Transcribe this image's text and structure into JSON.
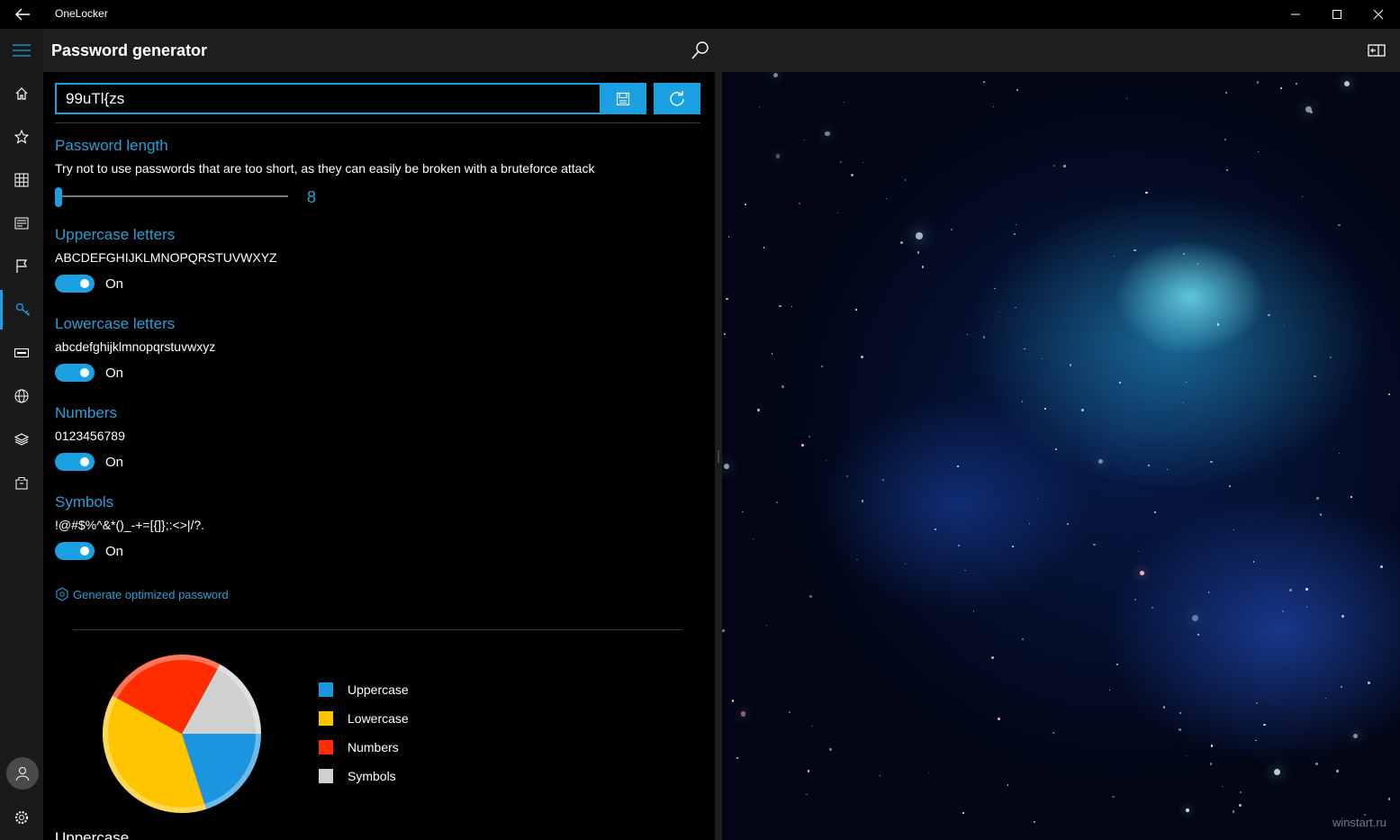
{
  "app": {
    "title": "OneLocker"
  },
  "header": {
    "page_title": "Password generator"
  },
  "generator": {
    "password_value": "99uTl{zs",
    "length_title": "Password length",
    "length_description": "Try not to use passwords that are too short, as they can easily be broken with a bruteforce attack",
    "length_value": "8",
    "length_level": 0.0
  },
  "options": [
    {
      "title": "Uppercase letters",
      "charset": "ABCDEFGHIJKLMNOPQRSTUVWXYZ",
      "state": "On"
    },
    {
      "title": "Lowercase letters",
      "charset": "abcdefghijklmnopqrstuvwxyz",
      "state": "On"
    },
    {
      "title": "Numbers",
      "charset": "0123456789",
      "state": "On"
    },
    {
      "title": "Symbols",
      "charset": "!@#$%^&*()_-+=[{]};:<>|/?.",
      "state": "On"
    }
  ],
  "generate_link": "Generate optimized password",
  "chart_data": {
    "type": "pie",
    "title": "",
    "categories": [
      "Uppercase",
      "Lowercase",
      "Numbers",
      "Symbols"
    ],
    "values": [
      20,
      38,
      25,
      17
    ],
    "colors": [
      "#1b95e0",
      "#ffc400",
      "#ff2d00",
      "#d0d0d0"
    ],
    "legend_position": "right"
  },
  "below_chart_label": "Uppercase",
  "watermark": "winstart.ru",
  "colors": {
    "accent": "#1ba1e2",
    "title_blue": "#2a9fd6"
  },
  "icons": {
    "nav": [
      "home-icon",
      "star-icon",
      "grid-icon",
      "card-icon",
      "flag-icon",
      "key-icon",
      "keyboard-icon",
      "globe-icon",
      "layers-icon",
      "bag-icon"
    ]
  }
}
